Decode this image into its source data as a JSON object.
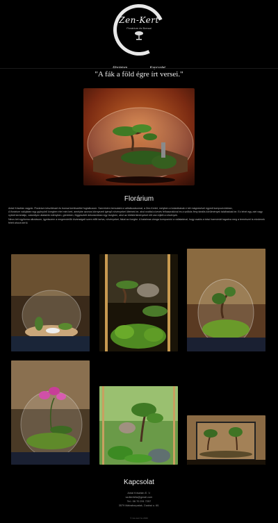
{
  "brand": {
    "name": "Zen-Kert",
    "tagline": "Florárium és Bonsai"
  },
  "nav": {
    "items": [
      {
        "label": "Florárium"
      },
      {
        "label": "Kapcsolat"
      }
    ]
  },
  "hero": {
    "quote": "\"A fák a föld égre írt versei.\""
  },
  "section_florarium": {
    "title": "Florárium",
    "paragraphs": [
      "Antal Krisztián vagyok. Florárium készítéssel és bonsai kertészettel foglalkozom. Szeretném bemutatni a vállalkozásomat, a Zen-Kertet, melyben a botanikának e két mágnesével egyedi kompozíciókban,",
      "A florárium valójában egy gyönyörű üvegben élet mini kert, amelybe azonos környezeti igényű növényeket ültetnek be, ahol ezáltal a kevés felhasználóval és a szűkös fény ideális körülmények találhatóak be. Ez lehet egy zárt vagy nyitott kerámiájú, valamilyen átalakító edényben, gömbben, függesztett dekorációban egy üvegben, ahol az életkörülményeket elő van rejtett a növények.",
      "Nincs két egyforma alkotásom, igyekszem a megrendelők kívánságait szem előtt tartva, növényeket, fákat az üvegbe. A hatalmas vizsga kompozíció a vállalatával, hogy csakis a tolsó harmóniát tagadva meg a természet is mindenek felett ahova kerül."
    ]
  },
  "section_contact": {
    "title": "Kapcsolat",
    "lines": [
      "Antal Krisztián E. V.",
      "szdkertefa@gmail.com",
      "Tel.: 06 70 291 7257",
      "3579 Mátraborpatak, Csabai u. 60."
    ]
  },
  "copyright": "© zen-kert.hu 2020"
}
